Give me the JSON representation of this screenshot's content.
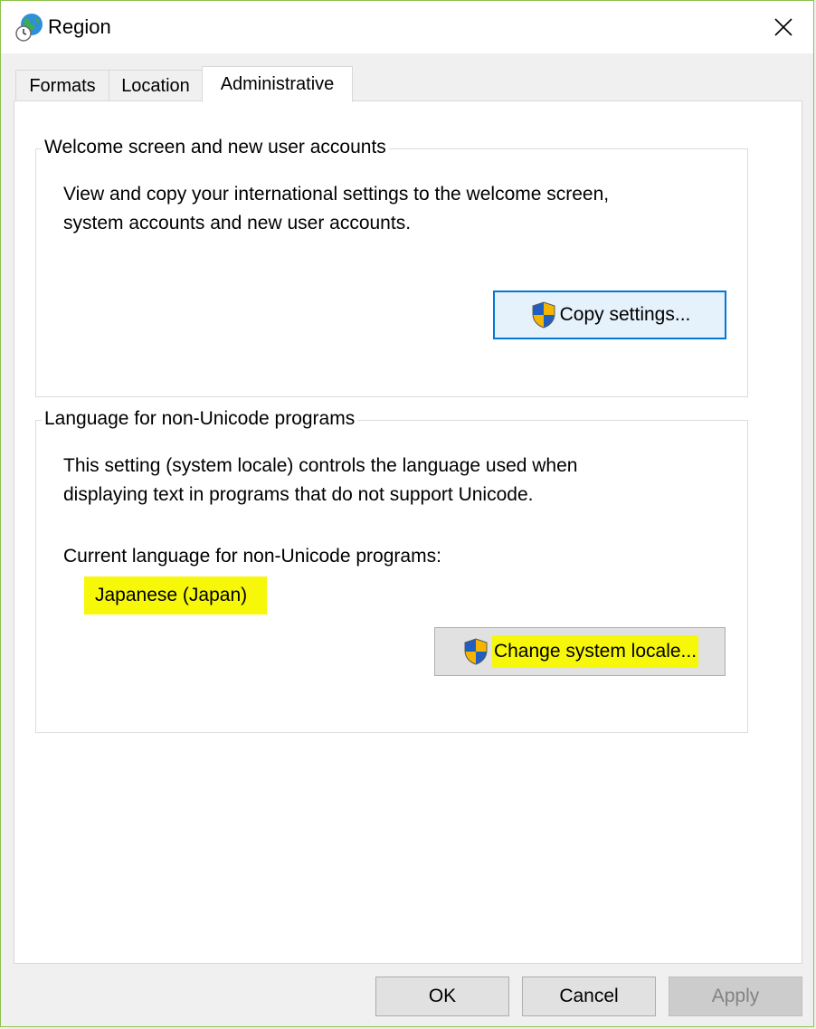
{
  "window": {
    "title": "Region",
    "close_glyph": "✕"
  },
  "tabs": [
    {
      "label": "Formats"
    },
    {
      "label": "Location"
    },
    {
      "label": "Administrative"
    }
  ],
  "welcome_group": {
    "legend": "Welcome screen and new user accounts",
    "description_line1": "View and copy your international settings to the welcome screen,",
    "description_line2": "system accounts and new user accounts.",
    "button_label": "Copy settings..."
  },
  "locale_group": {
    "legend": "Language for non-Unicode programs",
    "description_line1": "This setting (system locale) controls the language used when",
    "description_line2": "displaying text in programs that do not support Unicode.",
    "current_label": "Current language for non-Unicode programs:",
    "current_value": "Japanese (Japan)",
    "button_label": "Change system locale..."
  },
  "footer": {
    "ok_label": "OK",
    "cancel_label": "Cancel",
    "apply_label": "Apply"
  },
  "colors": {
    "highlight": "#f7f70a",
    "focus_border": "#0078d7",
    "frame": "#8bc34a"
  },
  "icons": {
    "title": "globe-clock-icon",
    "uac": "uac-shield-icon",
    "close": "close-icon"
  }
}
